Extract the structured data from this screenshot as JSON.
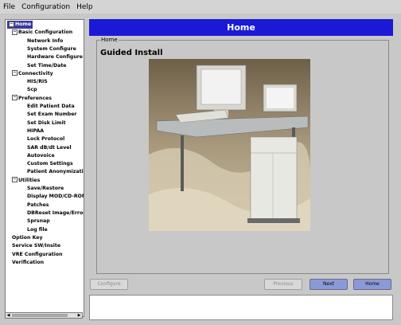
{
  "menu": [
    "File",
    "Configuration",
    "Help"
  ],
  "tree": [
    {
      "label": "Home",
      "level": 0,
      "expander": "−",
      "selected": true
    },
    {
      "label": "Basic Configuration",
      "level": 1,
      "expander": "−"
    },
    {
      "label": "Network Info",
      "level": 2
    },
    {
      "label": "System Configure",
      "level": 2
    },
    {
      "label": "Hardware Configure",
      "level": 2
    },
    {
      "label": "Set Time/Date",
      "level": 2
    },
    {
      "label": "Connectivity",
      "level": 1,
      "expander": "−"
    },
    {
      "label": "HIS/RIS",
      "level": 2
    },
    {
      "label": "Scp",
      "level": 2
    },
    {
      "label": "Preferences",
      "level": 1,
      "expander": "−"
    },
    {
      "label": "Edit Patient Data",
      "level": 2
    },
    {
      "label": "Set Exam Number",
      "level": 2
    },
    {
      "label": "Set Disk Limit",
      "level": 2
    },
    {
      "label": "HIPAA",
      "level": 2
    },
    {
      "label": "Lock Protocol",
      "level": 2
    },
    {
      "label": "SAR dB/dt Level",
      "level": 2
    },
    {
      "label": "Autovoice",
      "level": 2
    },
    {
      "label": "Custom Settings",
      "level": 2
    },
    {
      "label": "Patient Anonymization S",
      "level": 2
    },
    {
      "label": "Utilities",
      "level": 1,
      "expander": "−"
    },
    {
      "label": "Save/Restore",
      "level": 2
    },
    {
      "label": "Display MOD/CD-ROM",
      "level": 2
    },
    {
      "label": "Patches",
      "level": 2
    },
    {
      "label": "DBReset Image/Error DE",
      "level": 2
    },
    {
      "label": "Sprsnap",
      "level": 2
    },
    {
      "label": "Log file",
      "level": 2
    },
    {
      "label": "Option Key",
      "level": 1
    },
    {
      "label": "Service SW/Insite",
      "level": 1
    },
    {
      "label": "VRE Configuration",
      "level": 1
    },
    {
      "label": "Verification",
      "level": 1
    }
  ],
  "page": {
    "title": "Home",
    "group_label": "Home",
    "heading": "Guided Install"
  },
  "buttons": {
    "configure": "Configure",
    "previous": "Previous",
    "next": "Next",
    "home": "Home"
  },
  "icons": [
    "collapse-icon",
    "scroll-left-icon",
    "scroll-right-icon"
  ]
}
